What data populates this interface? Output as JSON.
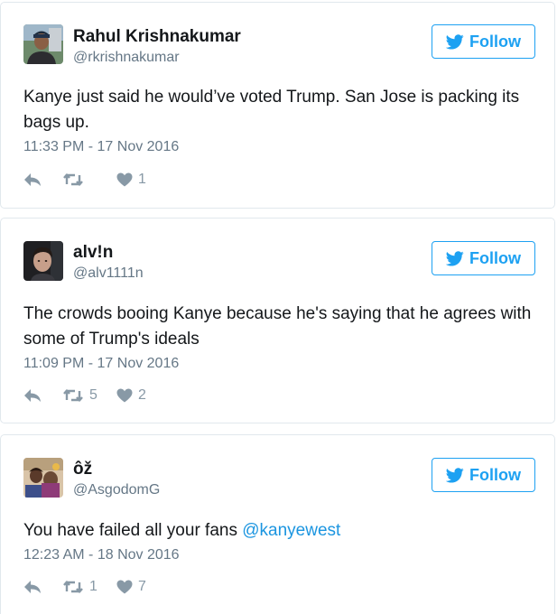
{
  "follow_label": "Follow",
  "colors": {
    "accent": "#1da1f2",
    "text": "#14171a",
    "secondary": "#657786",
    "icon": "#8899a6",
    "border": "#e1e8ed"
  },
  "tweets": [
    {
      "name": "Rahul Krishnakumar",
      "handle": "@rkrishnakumar",
      "text": "Kanye just said he would’ve voted Trump. San Jose is packing its bags up.",
      "timestamp": "11:33 PM - 17 Nov 2016",
      "retweets": "",
      "likes": "1"
    },
    {
      "name": "alv!n",
      "handle": "@alv1111n",
      "text": "The crowds booing Kanye because he's saying that he agrees with some of Trump's ideals",
      "timestamp": "11:09 PM - 17 Nov 2016",
      "retweets": "5",
      "likes": "2"
    },
    {
      "name": "ôž",
      "handle": "@AsgodomG",
      "text": "You have failed all your fans ",
      "mention": "@kanyewest",
      "timestamp": "12:23 AM - 18 Nov 2016",
      "retweets": "1",
      "likes": "7"
    }
  ]
}
